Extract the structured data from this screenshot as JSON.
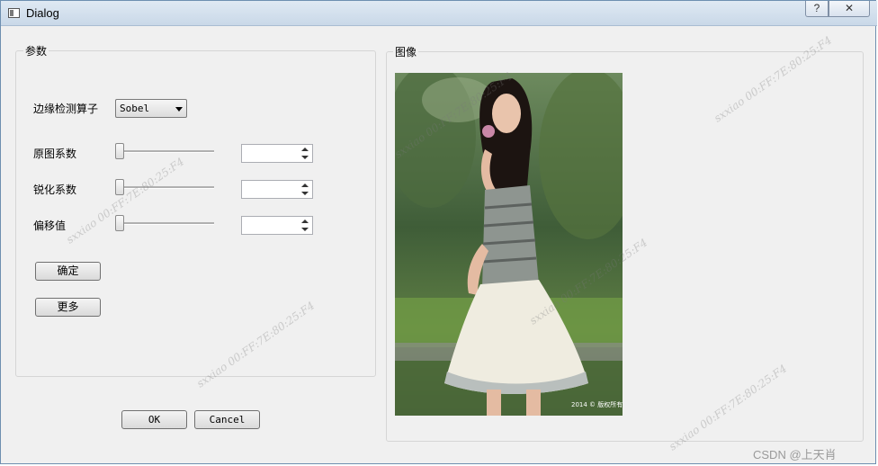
{
  "window": {
    "title": "Dialog",
    "help_button": "?",
    "close_button": "✕"
  },
  "params": {
    "title": "参数",
    "operator_label": "边缘检测算子",
    "operator_value": "Sobel",
    "original_coef_label": "原图系数",
    "original_coef_value": "",
    "sharpen_coef_label": "锐化系数",
    "sharpen_coef_value": "",
    "offset_label": "偏移值",
    "offset_value": "",
    "confirm_button": "确定",
    "more_button": "更多"
  },
  "image_panel": {
    "title": "图像",
    "image_caption": "2014 © 版权所有"
  },
  "footer": {
    "ok_button": "OK",
    "cancel_button": "Cancel"
  },
  "watermark": {
    "text": "sxxiao 00:FF:7E:80:25:F4",
    "credit": "CSDN @上天肖"
  }
}
